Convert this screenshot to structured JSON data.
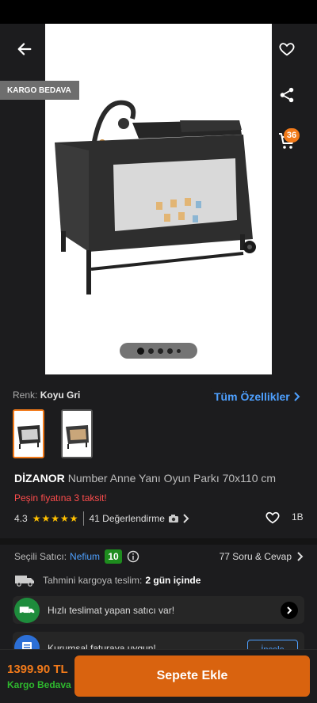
{
  "gallery": {
    "shipping_tag": "KARGO BEDAVA",
    "cart_count": "36",
    "all_features_label": "Tüm Özellikler",
    "slide_index": 1,
    "slide_total": 5
  },
  "product": {
    "color_label": "Renk:",
    "color_value": "Koyu Gri",
    "brand": "DİZANOR",
    "name": "Number Anne Yanı Oyun Parkı 70x110 cm",
    "installment_text": "Peşin fiyatına 3 taksit!",
    "rating": "4.3",
    "stars": "★★★★★",
    "reviews_label": "41 Değerlendirme",
    "favorites": "1B"
  },
  "seller": {
    "label": "Seçili Satıcı:",
    "name": "Nefium",
    "score": "10",
    "qa_label": "77 Soru & Cevap"
  },
  "delivery": {
    "label": "Tahmini kargoya teslim:",
    "value": "2 gün içinde"
  },
  "banners": {
    "fast_delivery": "Hızlı teslimat yapan satıcı var!",
    "corporate": "Kurumsal faturaya uygun!",
    "corporate_button": "İncele"
  },
  "footer": {
    "price": "1399.90 TL",
    "free_shipping": "Kargo Bedava",
    "add_to_cart": "Sepete Ekle"
  },
  "colors": {
    "accent": "#f27a1a",
    "link": "#4ea0ff",
    "success": "#1e8c1e",
    "background": "#1c1c1e"
  }
}
